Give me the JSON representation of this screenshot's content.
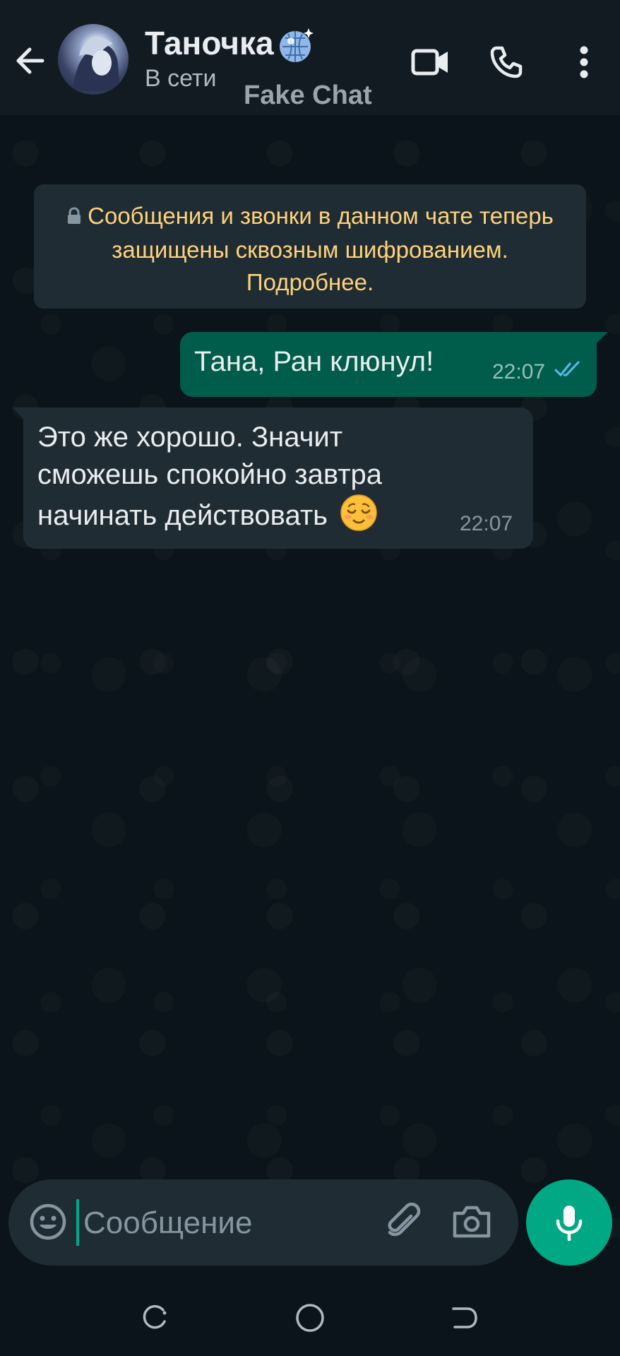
{
  "header": {
    "contact_name": "Таночка",
    "status": "В сети",
    "watermark": "Fake Chat",
    "icons": {
      "back": "arrow-left-icon",
      "video": "video-camera-icon",
      "call": "phone-icon",
      "more": "more-vertical-icon",
      "name_emoji": "mirror-ball-emoji"
    }
  },
  "encryption_notice": {
    "text": "Сообщения и звонки в данном чате теперь защищены сквозным шифрованием. Подробнее.",
    "icon": "lock-icon",
    "color": "#ffd279"
  },
  "messages": [
    {
      "direction": "outgoing",
      "text": "Тана, Ран клюнул!",
      "time": "22:07",
      "read_status": "read",
      "bubble_color": "#005c4b"
    },
    {
      "direction": "incoming",
      "text": "Это же хорошо. Значит сможешь спокойно завтра начинать действовать",
      "emoji": "relieved-face-emoji",
      "time": "22:07",
      "bubble_color": "#202c33"
    }
  ],
  "composer": {
    "placeholder": "Сообщение",
    "icons": {
      "emoji": "emoji-face-icon",
      "attach": "paperclip-icon",
      "camera": "camera-icon",
      "mic": "microphone-icon"
    },
    "accent_color": "#00a884"
  },
  "navigation": {
    "icons": [
      "recent-apps-icon",
      "home-icon",
      "back-icon"
    ]
  }
}
